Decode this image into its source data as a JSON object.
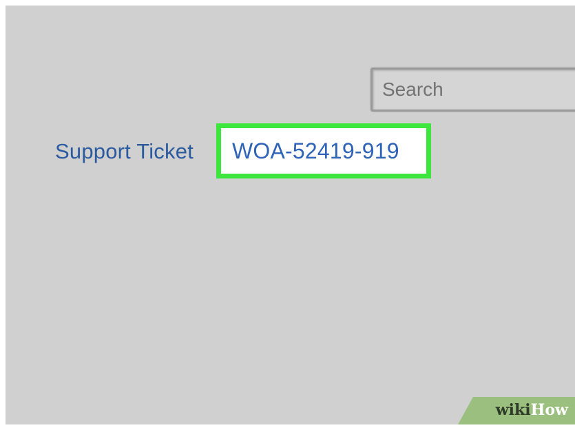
{
  "search": {
    "placeholder": "Search"
  },
  "ticket": {
    "label": "Support Ticket",
    "number": "WOA-52419-919"
  },
  "highlight": {
    "color": "#3de63d"
  },
  "watermark": {
    "part1": "wiki",
    "part2": "How"
  }
}
